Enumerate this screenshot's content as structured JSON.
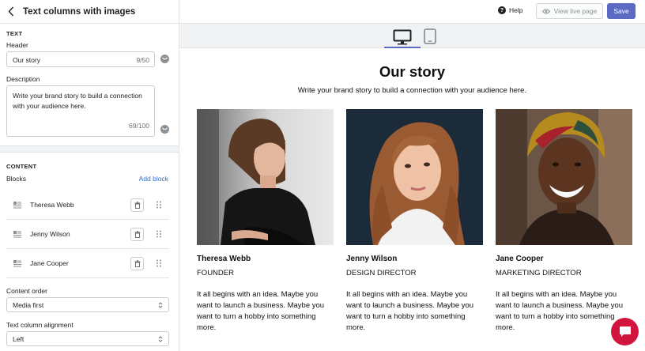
{
  "sidebar": {
    "title": "Text columns with images",
    "text_section": "TEXT",
    "header_label": "Header",
    "header_value": "Our story",
    "header_counter": "9/50",
    "description_label": "Description",
    "description_value": "Write your brand story to build a connection with your audience here.",
    "description_counter": "69/100",
    "content_section": "CONTENT",
    "blocks_label": "Blocks",
    "add_block": "Add block",
    "blocks": [
      {
        "label": "Theresa Webb"
      },
      {
        "label": "Jenny Wilson"
      },
      {
        "label": "Jane Cooper"
      }
    ],
    "content_order_label": "Content order",
    "content_order_value": "Media first",
    "alignment_label": "Text column alignment",
    "alignment_value": "Left"
  },
  "topbar": {
    "help": "Help",
    "view_live": "View live page",
    "save": "Save"
  },
  "preview": {
    "heading": "Our story",
    "subheading": "Write your brand story to build a connection with your audience here.",
    "columns": [
      {
        "name": "Theresa Webb",
        "role": "FOUNDER",
        "text": "It all begins with an idea. Maybe you want to launch a business. Maybe you want to turn a hobby into something more."
      },
      {
        "name": "Jenny Wilson",
        "role": "DESIGN DIRECTOR",
        "text": "It all begins with an idea. Maybe you want to launch a business. Maybe you want to turn a hobby into something more."
      },
      {
        "name": "Jane Cooper",
        "role": "MARKETING DIRECTOR",
        "text": "It all begins with an idea. Maybe you want to launch a business. Maybe you want to turn a hobby into something more."
      }
    ]
  },
  "colors": {
    "primary": "#5c6ac4",
    "link": "#2c6ecb",
    "chat": "#d1153c"
  },
  "icons": [
    "chevron-left-icon",
    "ai-sparkle-icon",
    "text-block-icon",
    "trash-icon",
    "drag-handle-icon",
    "select-arrows-icon",
    "help-icon",
    "eye-icon",
    "desktop-icon",
    "mobile-icon",
    "chat-icon"
  ]
}
